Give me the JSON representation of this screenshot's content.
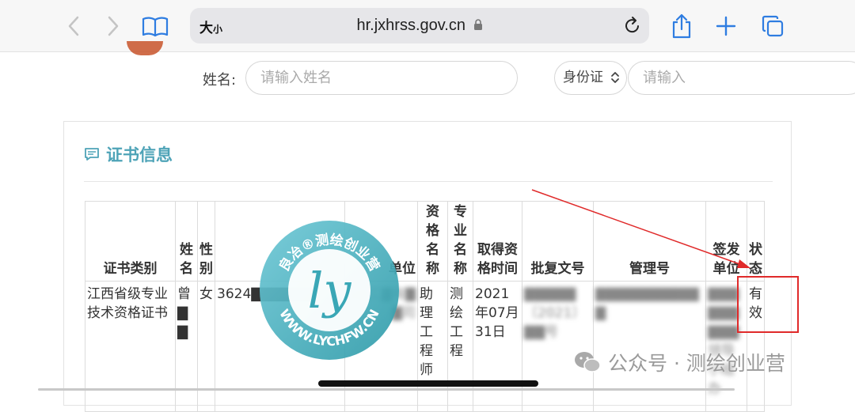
{
  "browser": {
    "text_size_label": "大",
    "text_size_small": "小",
    "url": "hr.jxhrss.gov.cn"
  },
  "form": {
    "name_label": "姓名:",
    "name_placeholder": "请输入姓名",
    "id_type": "身份证",
    "id_placeholder": "请输入"
  },
  "section": {
    "title": "证书信息"
  },
  "table": {
    "headers": [
      "证书类别",
      "姓名",
      "性别",
      "",
      "单位",
      "资格名称",
      "专业名称",
      "取得资格时间",
      "批复文号",
      "管理号",
      "签发单位",
      "状态"
    ],
    "row": {
      "category": "江西省级专业技术资格证书",
      "name": "曾▇▇",
      "gender": "女",
      "id_number": "3624▇▇▇▇▇▇",
      "unit": "▇▇工▇有▇▇司",
      "qualification": "助理工程师",
      "major": "测绘工程",
      "date": "2021年07月31日",
      "approval_no": "▇▇▇▇▇〔2021〕▇▇号",
      "manage_no": "▇▇▇▇▇▇▇▇▇▇▇",
      "issuer": "▇▇▇▇▇▇▇▇▇领导小组办",
      "status": "有效"
    }
  },
  "watermark": {
    "ring_text": "良冶®测绘创业营",
    "logo_text": "ly",
    "site": "WWW.LYCHFW.CN"
  },
  "footer": {
    "account": "公众号 · 测绘创业营"
  }
}
